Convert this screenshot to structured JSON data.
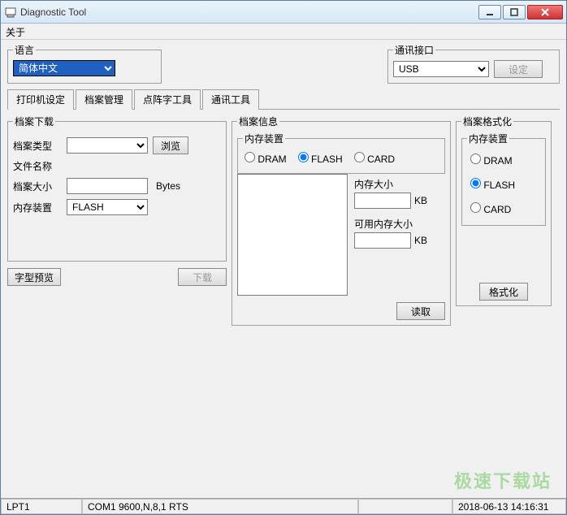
{
  "window": {
    "title": "Diagnostic Tool"
  },
  "menu": {
    "about": "关于"
  },
  "groups": {
    "language": {
      "legend": "语言",
      "selected": "简体中文"
    },
    "comm": {
      "legend": "通讯接口",
      "selected": "USB",
      "set_btn": "设定"
    }
  },
  "tabs": {
    "t1": "打印机设定",
    "t2": "档案管理",
    "t3": "点阵字工具",
    "t4": "通讯工具"
  },
  "download": {
    "legend": "档案下载",
    "fields": {
      "filetype": "档案类型",
      "filename": "文件名称",
      "filesize": "档案大小",
      "memdev": "内存装置"
    },
    "filetype_value": "",
    "filename_value": "",
    "filesize_value": "",
    "filesize_unit": "Bytes",
    "memdev_value": "FLASH",
    "browse_btn": "浏览",
    "preview_btn": "字型预览",
    "download_btn": "下载"
  },
  "fileinfo": {
    "legend": "档案信息",
    "mem_legend": "内存装置",
    "radios": {
      "dram": "DRAM",
      "flash": "FLASH",
      "card": "CARD"
    },
    "selected": "flash",
    "memsize_label": "内存大小",
    "memsize_value": "",
    "memfree_label": "可用内存大小",
    "memfree_value": "",
    "unit": "KB",
    "read_btn": "读取"
  },
  "format": {
    "legend": "档案格式化",
    "mem_legend": "内存装置",
    "radios": {
      "dram": "DRAM",
      "flash": "FLASH",
      "card": "CARD"
    },
    "selected": "flash",
    "format_btn": "格式化"
  },
  "status": {
    "port": "LPT1",
    "com": "COM1 9600,N,8,1 RTS",
    "datetime": "2018-06-13 14:16:31"
  },
  "watermark": "极速下载站"
}
